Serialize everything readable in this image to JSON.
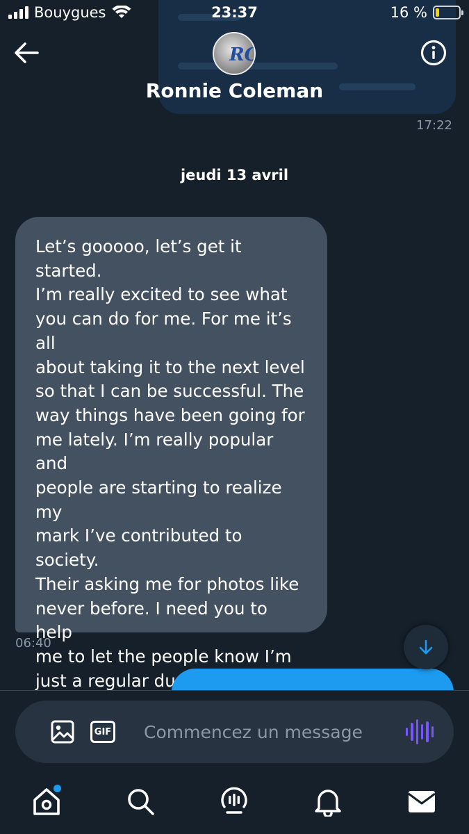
{
  "status_bar": {
    "carrier": "Bouygues",
    "time": "23:37",
    "battery": "16 %",
    "battery_level": 0.16
  },
  "header": {
    "contact_name": "Ronnie Coleman",
    "avatar_monogram": "RC"
  },
  "conversation": {
    "previous_time": "17:22",
    "date_separator": "jeudi 13 avril",
    "incoming_message": {
      "text": "Let’s gooooo, let’s get it started.\nI’m really excited to see what\nyou can do for me. For me it’s all\nabout taking it to the next level\nso that I can be successful. The\nway things have been going for\nme lately. I’m really popular and\npeople are starting to realize my\nmark I’ve contributed to society.\nTheir asking me for photos like\nnever before. I need you to help\nme to let the people know I’m\njust a regular dude just like\nthem who’s trying his best to\ncome up and do what it takes to\nbe successful.",
      "time": "06:40"
    }
  },
  "composer": {
    "gif_label": "GIF",
    "placeholder": "Commencez un message"
  },
  "colors": {
    "background": "#15202b",
    "incoming_bubble": "#435160",
    "outgoing_bubble": "#1d9bf0",
    "voice_accent": "#7856ff",
    "secondary_text": "#8b98a5"
  },
  "icons": {
    "back": "arrow-left-icon",
    "info": "info-icon",
    "media": "image-icon",
    "gif": "gif-icon",
    "voice": "voice-wave-icon",
    "scroll": "arrow-down-icon",
    "tabs": [
      "home-icon",
      "search-icon",
      "spaces-icon",
      "bell-icon",
      "mail-icon"
    ]
  }
}
